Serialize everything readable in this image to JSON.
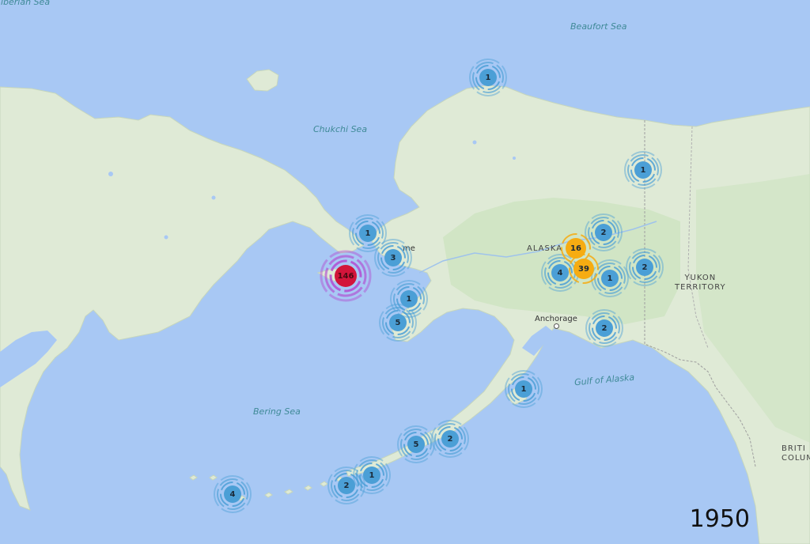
{
  "colors": {
    "water": "#a8c8f4",
    "land": "#dfead6",
    "land_green": "#cde3c0",
    "ring_blue": "#4b9fd6",
    "core_blue": "#4b9fd6",
    "core_orange": "#f6ac12",
    "core_red": "#d2153b",
    "ring_purple": "#b14bd1"
  },
  "labels": {
    "east_siberian_sea": "Siberian Sea",
    "beaufort_sea": "Beaufort Sea",
    "chukchi_sea": "Chukchi Sea",
    "bering_sea": "Bering Sea",
    "gulf_of_alaska": "Gulf of Alaska",
    "alaska": "ALASKA",
    "yukon": "YUKON",
    "territory": "TERRITORY",
    "british": "BRITI",
    "columbia": "COLUM",
    "anchorage": "Anchorage",
    "nome": "me"
  },
  "year": "1950",
  "clusters": [
    {
      "id": "north-slope",
      "count": "1",
      "tier": "small"
    },
    {
      "id": "northeast-alaska",
      "count": "1",
      "tier": "small"
    },
    {
      "id": "seward-peninsula",
      "count": "1",
      "tier": "small"
    },
    {
      "id": "nome",
      "count": "3",
      "tier": "small"
    },
    {
      "id": "st-lawrence-island",
      "count": "146",
      "tier": "large"
    },
    {
      "id": "yukon-delta-north",
      "count": "1",
      "tier": "small"
    },
    {
      "id": "yukon-delta-south",
      "count": "5",
      "tier": "small"
    },
    {
      "id": "interior-north",
      "count": "2",
      "tier": "small"
    },
    {
      "id": "fairbanks-north",
      "count": "16",
      "tier": "medium"
    },
    {
      "id": "fairbanks",
      "count": "39",
      "tier": "medium"
    },
    {
      "id": "interior-west",
      "count": "4",
      "tier": "small"
    },
    {
      "id": "interior-south",
      "count": "1",
      "tier": "small"
    },
    {
      "id": "yukon-border",
      "count": "2",
      "tier": "small"
    },
    {
      "id": "anchorage-east",
      "count": "2",
      "tier": "small"
    },
    {
      "id": "kodiak",
      "count": "1",
      "tier": "small"
    },
    {
      "id": "alaska-peninsula-east",
      "count": "2",
      "tier": "small"
    },
    {
      "id": "alaska-peninsula-west",
      "count": "5",
      "tier": "small"
    },
    {
      "id": "aleutians-east",
      "count": "1",
      "tier": "small"
    },
    {
      "id": "aleutians-central",
      "count": "2",
      "tier": "small"
    },
    {
      "id": "aleutians-west",
      "count": "4",
      "tier": "small"
    }
  ]
}
